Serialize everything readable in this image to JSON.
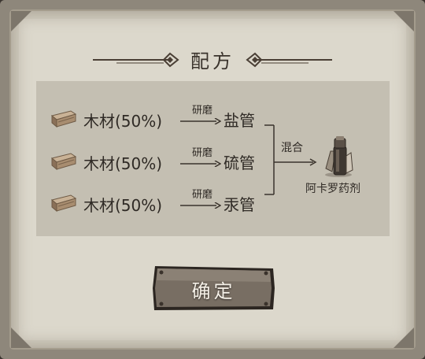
{
  "dialog": {
    "title": "配方",
    "recipe": {
      "inputs": [
        {
          "material": "木材(50%)",
          "process": "研磨",
          "product": "盐管",
          "icon": "wood-plank-icon"
        },
        {
          "material": "木材(50%)",
          "process": "研磨",
          "product": "硫管",
          "icon": "wood-plank-icon"
        },
        {
          "material": "木材(50%)",
          "process": "研磨",
          "product": "汞管",
          "icon": "wood-plank-icon"
        }
      ],
      "combine_label": "混合",
      "result": {
        "name": "阿卡罗药剂",
        "icon": "potion-vial-icon"
      }
    },
    "confirm_label": "确定"
  },
  "colors": {
    "panel": "#dcd8cc",
    "recipe_box": "#c4bfb2",
    "button": "#766d62",
    "text": "#2f2a25"
  }
}
